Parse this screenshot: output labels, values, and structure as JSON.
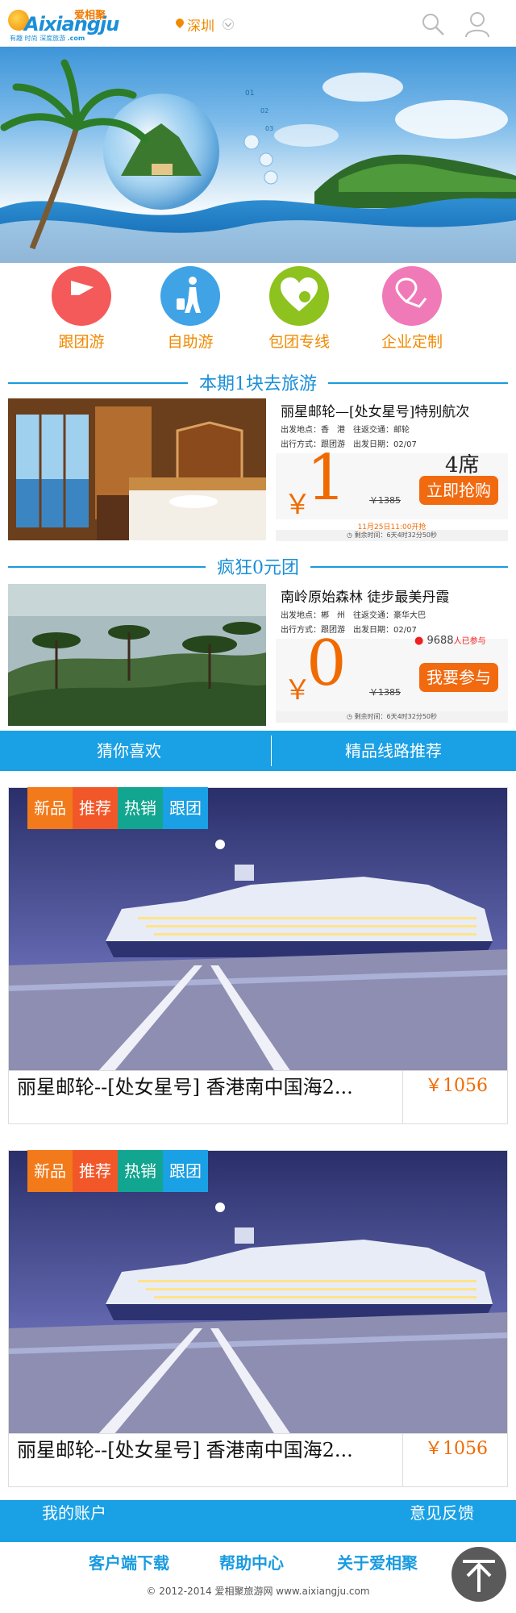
{
  "header": {
    "logo_text": "Aixiangju",
    "logo_cn": "爱相聚",
    "logo_slogan": "有趣 时尚 深度旅游",
    "logo_domain": ".com",
    "city": "深圳"
  },
  "banner": {
    "slides": [
      "01",
      "02",
      "03"
    ]
  },
  "categories": [
    {
      "label": "跟团游",
      "color": "#f45a5a"
    },
    {
      "label": "自助游",
      "color": "#3fa3e6"
    },
    {
      "label": "包团专线",
      "color": "#8dc21f"
    },
    {
      "label": "企业定制",
      "color": "#f07ab8"
    }
  ],
  "sections": {
    "one_yuan": "本期1块去旅游",
    "zero_yuan": "疯狂0元团"
  },
  "deal1": {
    "name": "丽星邮轮—[处女星号]特别航次",
    "depart_label": "出发地点：香　港",
    "transport_label": "往返交通：邮轮",
    "mode_label": "出行方式：跟团游",
    "date_label": "出发日期：02/07",
    "currency": "￥",
    "price": "1",
    "original": "￥1385",
    "seats": "4席",
    "cta": "立即抢购",
    "start": "11月25日11:00开抢",
    "countdown": "剩余时间：6天4时32分50秒"
  },
  "deal2": {
    "name": "南岭原始森林  徒步最美丹霞",
    "depart_label": "出发地点：郴　州",
    "transport_label": "往返交通：豪华大巴",
    "mode_label": "出行方式：跟团游",
    "date_label": "出发日期：02/07",
    "currency": "￥",
    "price": "0",
    "original": "￥1385",
    "participants": "9688",
    "participants_unit": "人已参与",
    "cta": "我要参与",
    "countdown": "剩余时间：6天4时32分50秒"
  },
  "tabs": [
    "猜你喜欢",
    "精品线路推荐"
  ],
  "tags": [
    {
      "label": "新品",
      "color": "#f27a1a"
    },
    {
      "label": "推荐",
      "color": "#f2572a"
    },
    {
      "label": "热销",
      "color": "#12a58f"
    },
    {
      "label": "跟团",
      "color": "#1aa0e4"
    }
  ],
  "products": [
    {
      "title": "丽星邮轮--[处女星号] 香港南中国海2...",
      "price": "￥1056"
    },
    {
      "title": "丽星邮轮--[处女星号] 香港南中国海2...",
      "price": "￥1056"
    }
  ],
  "footer": {
    "account": "我的账户",
    "feedback": "意见反馈",
    "links": [
      "客户端下载",
      "帮助中心",
      "关于爱相聚"
    ],
    "copyright": "©  2012-2014 爱相聚旅游网 www.aixiangju.com"
  }
}
